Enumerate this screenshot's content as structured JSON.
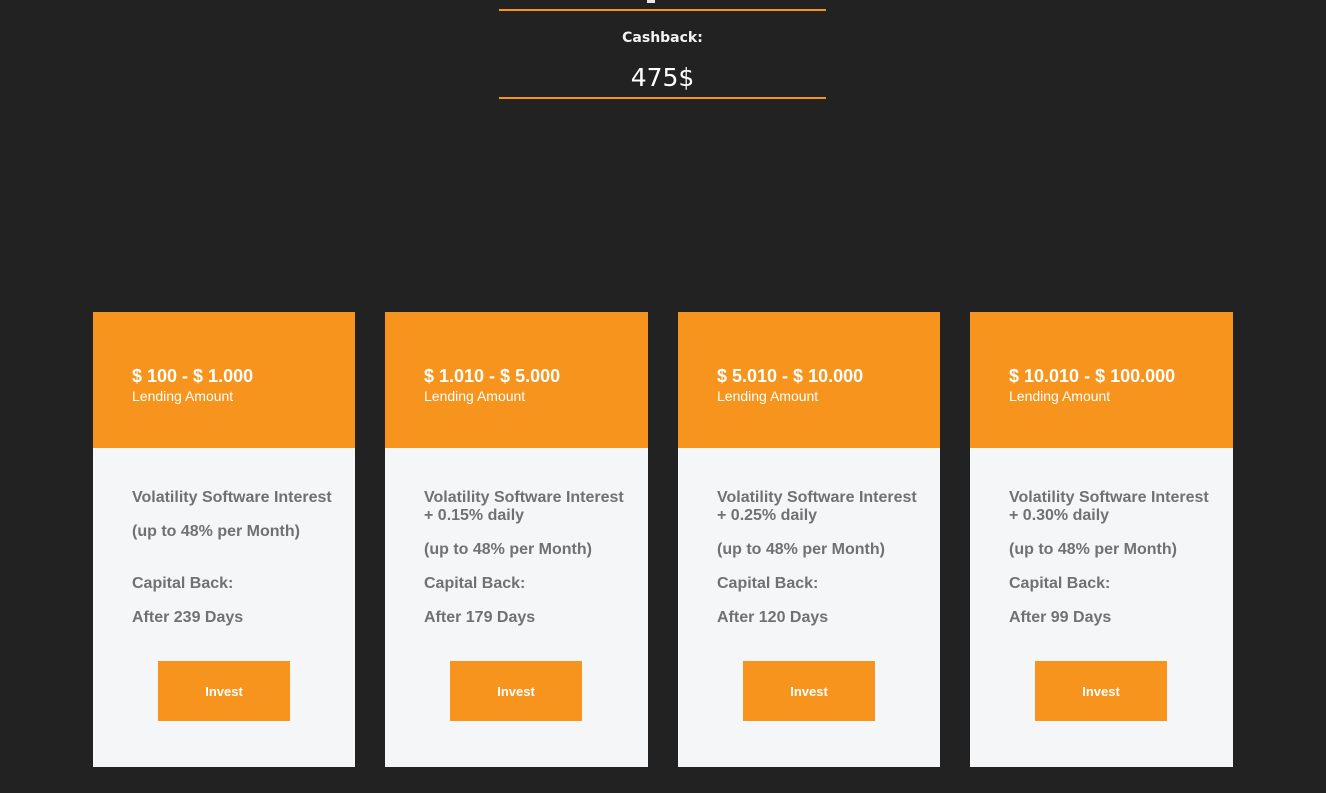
{
  "calculator": {
    "cashback_label": "Cashback:",
    "cashback_value": "475$"
  },
  "accent_color": "#f7941d",
  "plans": [
    {
      "range": "$ 100 - $ 1.000",
      "sublabel": "Lending Amount",
      "interest": "Volatility Software Interest",
      "monthly": "(up to 48% per Month)",
      "capital_label": "Capital Back:",
      "capital_value": "After 239 Days",
      "button": "Invest"
    },
    {
      "range": "$ 1.010 - $ 5.000",
      "sublabel": "Lending Amount",
      "interest": "Volatility Software Interest + 0.15% daily",
      "monthly": "(up to 48% per Month)",
      "capital_label": "Capital Back:",
      "capital_value": "After 179 Days",
      "button": "Invest"
    },
    {
      "range": "$ 5.010 - $ 10.000",
      "sublabel": "Lending Amount",
      "interest": "Volatility Software Interest + 0.25% daily",
      "monthly": "(up to 48% per Month)",
      "capital_label": "Capital Back:",
      "capital_value": "After 120 Days",
      "button": "Invest"
    },
    {
      "range": "$ 10.010 - $ 100.000",
      "sublabel": "Lending Amount",
      "interest": "Volatility Software Interest + 0.30% daily",
      "monthly": "(up to 48% per Month)",
      "capital_label": "Capital Back:",
      "capital_value": "After 99 Days",
      "button": "Invest"
    }
  ]
}
